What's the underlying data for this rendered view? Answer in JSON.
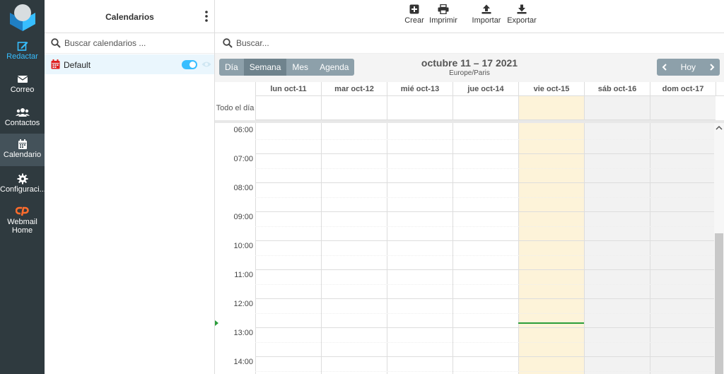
{
  "nav": {
    "items": [
      {
        "label": "Redactar",
        "icon": "compose-icon"
      },
      {
        "label": "Correo",
        "icon": "mail-icon"
      },
      {
        "label": "Contactos",
        "icon": "contacts-icon"
      },
      {
        "label": "Calendario",
        "icon": "calendar-icon"
      },
      {
        "label": "Configuraci...",
        "icon": "gear-icon"
      },
      {
        "label": "Webmail Home",
        "icon": "cpanel-icon"
      }
    ],
    "active": "Calendario"
  },
  "calendars": {
    "title": "Calendarios",
    "search_placeholder": "Buscar calendarios ...",
    "items": [
      {
        "name": "Default",
        "color": "#e02020",
        "enabled": true
      }
    ]
  },
  "toolbar": {
    "create": "Crear",
    "print": "Imprimir",
    "import": "Importar",
    "export": "Exportar"
  },
  "search": {
    "placeholder": "Buscar..."
  },
  "views": {
    "day": "Día",
    "week": "Semana",
    "month": "Mes",
    "agenda": "Agenda",
    "active": "Semana"
  },
  "range": {
    "title": "octubre 11 – 17 2021",
    "timezone": "Europe/Paris"
  },
  "navigation": {
    "today": "Hoy"
  },
  "grid": {
    "all_day_label": "Todo el día",
    "days": [
      {
        "label": "lun oct-11",
        "today": false,
        "weekend": false
      },
      {
        "label": "mar oct-12",
        "today": false,
        "weekend": false
      },
      {
        "label": "mié oct-13",
        "today": false,
        "weekend": false
      },
      {
        "label": "jue oct-14",
        "today": false,
        "weekend": false
      },
      {
        "label": "vie oct-15",
        "today": true,
        "weekend": false
      },
      {
        "label": "sáb oct-16",
        "today": false,
        "weekend": true
      },
      {
        "label": "dom oct-17",
        "today": false,
        "weekend": true
      }
    ],
    "hours": [
      "06:00",
      "07:00",
      "08:00",
      "09:00",
      "10:00",
      "11:00",
      "12:00",
      "13:00",
      "14:00"
    ],
    "now_time": "13:00"
  },
  "colors": {
    "nav_bg": "#2f3a3f",
    "accent": "#37beff",
    "today_bg": "#fdf3d9",
    "weekend_bg": "#f2f2f2",
    "now_line": "#2a9d3a",
    "button_bg": "#8da0aa"
  }
}
